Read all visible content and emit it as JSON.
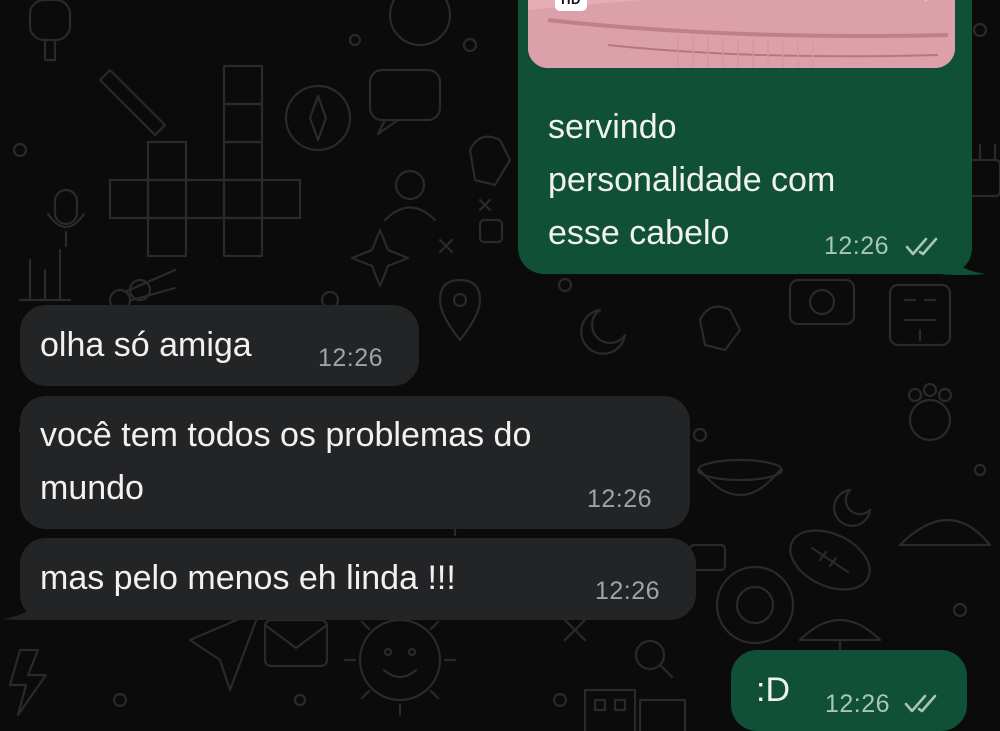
{
  "colors": {
    "background": "#0b0b0b",
    "incoming_bubble": "#232426",
    "outgoing_bubble": "#0f5037",
    "message_text": "#f1f1f1",
    "read_ticks": "#a9c4b8"
  },
  "chat": {
    "messages": [
      {
        "direction": "outgoing",
        "has_image": true,
        "image_badge": "HD",
        "lines": [
          "servindo",
          "personalidade com",
          "esse cabelo"
        ],
        "time": "12:26",
        "status_icon": "double-check-icon"
      },
      {
        "direction": "incoming",
        "lines": [
          "olha só amiga"
        ],
        "time": "12:26"
      },
      {
        "direction": "incoming",
        "lines": [
          "você tem todos os problemas do",
          "mundo"
        ],
        "time": "12:26"
      },
      {
        "direction": "incoming",
        "lines": [
          "mas pelo menos eh linda !!!"
        ],
        "time": "12:26"
      },
      {
        "direction": "outgoing",
        "lines": [
          ":D"
        ],
        "time": "12:26",
        "status_icon": "double-check-icon"
      }
    ]
  }
}
